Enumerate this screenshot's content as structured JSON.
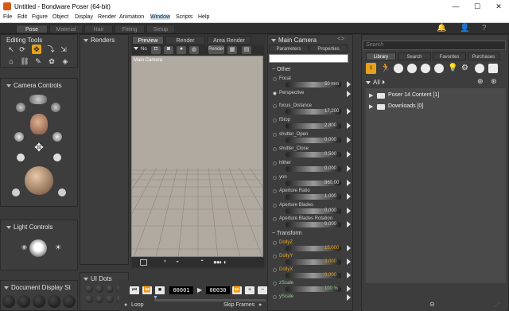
{
  "title_bar": {
    "title": "Untitled - Bondware Poser (64-bit)",
    "minimize": "—",
    "maximize": "☐",
    "close": "✕"
  },
  "menu": [
    "File",
    "Edit",
    "Figure",
    "Object",
    "Display",
    "Render",
    "Animation",
    "Window",
    "Scripts",
    "Help"
  ],
  "rooms": [
    "Pose",
    "Material",
    "Hair",
    "Fitting",
    "Setup"
  ],
  "active_room": "Pose",
  "editing_tools": {
    "title": "Editing Tools"
  },
  "camera_controls": {
    "title": "Camera Controls"
  },
  "light_controls": {
    "title": "Light Controls"
  },
  "document_display": {
    "title": "Document Display St"
  },
  "renders_panel": {
    "title": "Renders"
  },
  "ui_dots": {
    "title": "UI Dots"
  },
  "viewport": {
    "tabs": [
      "Preview",
      "Render",
      "Area Render"
    ],
    "active_tab": "Preview",
    "camera_label": "Main Camera",
    "no_label": "No"
  },
  "animation_bar": {
    "frame_current": "00001",
    "frame_total": "00030",
    "loop_label": "Loop",
    "skip_frames_label": "Skip Frames"
  },
  "parameters": {
    "title": "Main Camera",
    "tabs": [
      "Parameters",
      "Properties"
    ],
    "groups": [
      "Other",
      "Transform"
    ],
    "rows": [
      {
        "label": "Focal",
        "value": "50 mm"
      },
      {
        "label": "Perspective",
        "value": ""
      },
      {
        "label": "focus_Distance",
        "value": "17,200"
      },
      {
        "label": "fStop",
        "value": "2,800"
      },
      {
        "label": "shutter_Open",
        "value": "0,000"
      },
      {
        "label": "shutter_Close",
        "value": "0,500"
      },
      {
        "label": "hither",
        "value": "0,000"
      },
      {
        "label": "yon",
        "value": "860,00"
      },
      {
        "label": "Aperture Ratio",
        "value": "1,000"
      },
      {
        "label": "Aperture Blades",
        "value": "0,000"
      },
      {
        "label": "Aperture Blades Rotation",
        "value": "0,000"
      }
    ],
    "transform_rows": [
      {
        "label": "DollyZ",
        "value": "15,000"
      },
      {
        "label": "DollyY",
        "value": "3,000"
      },
      {
        "label": "DollyX",
        "value": "0,000"
      },
      {
        "label": "zScale",
        "value": "100 %"
      },
      {
        "label": "yScale",
        "value": ""
      }
    ]
  },
  "library": {
    "search_placeholder": "Search",
    "tabs": [
      "Library",
      "Search",
      "Favorites",
      "Purchases"
    ],
    "active_tab": "Library",
    "filter_label": "All",
    "folders": [
      {
        "name": "Poser 14 Content",
        "count": "[1]"
      },
      {
        "name": "Downloads",
        "count": "[0]"
      }
    ]
  },
  "colors": {
    "accent": "#e8a21a",
    "panel_bg": "#3d3d3d",
    "viewport_bg": "#b1aaa0"
  }
}
